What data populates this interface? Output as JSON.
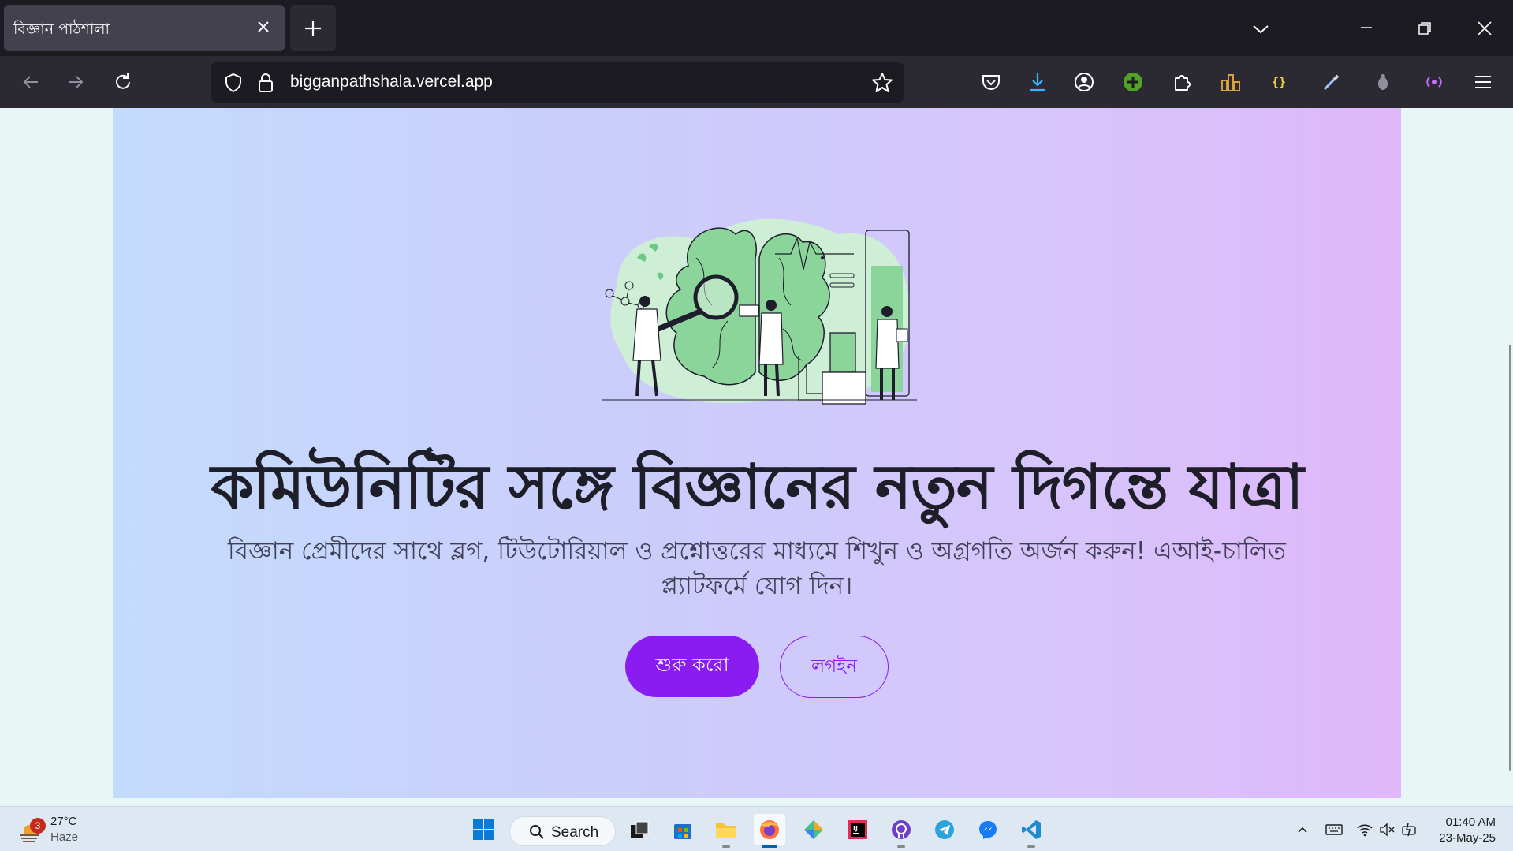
{
  "browser": {
    "tab": {
      "title": "বিজ্ঞান পাঠশালা"
    },
    "url": "bigganpathshala.vercel.app"
  },
  "hero": {
    "headline": "কমিউনিটির সঙ্গে বিজ্ঞানের নতুন দিগন্তে যাত্রা",
    "subtitle": "বিজ্ঞান প্রেমীদের সাথে ব্লগ, টিউটোরিয়াল ও প্রশ্নোত্তরের মাধ্যমে শিখুন ও অগ্রগতি অর্জন করুন! এআই-চালিত প্ল্যাটফর্মে যোগ দিন।",
    "primary_button": "শুরু করো",
    "secondary_button": "লগইন"
  },
  "taskbar": {
    "weather_badge": "3",
    "weather_temp": "27°C",
    "weather_condition": "Haze",
    "search_label": "Search",
    "time": "01:40 AM",
    "date": "23-May-25"
  },
  "colors": {
    "accent": "#8a1cf2",
    "headline": "#1e1e28",
    "tabstrip": "#1c1b22",
    "navbar": "#2b2a33"
  }
}
